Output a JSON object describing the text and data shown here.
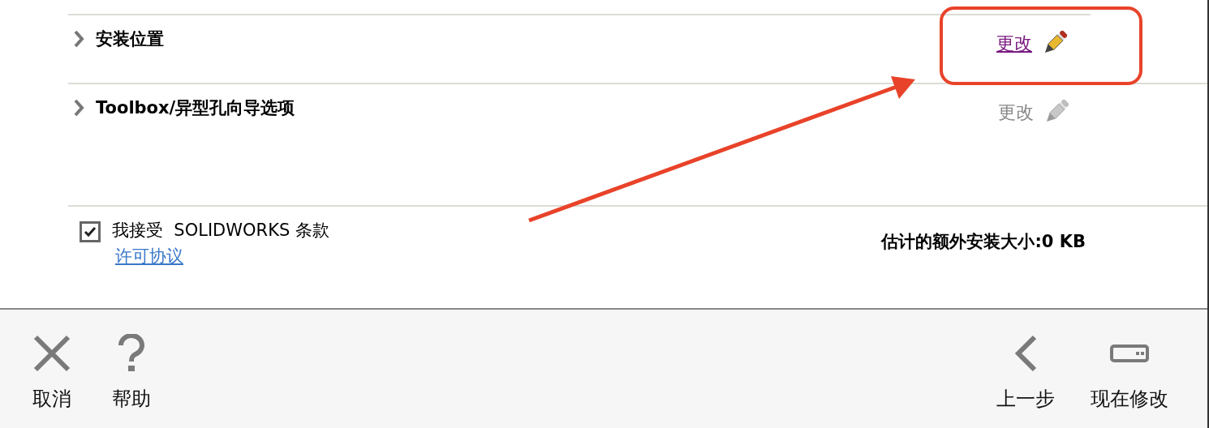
{
  "sections": [
    {
      "label": "安装位置",
      "expanded": false,
      "action": {
        "label": "更改",
        "disabled": false
      }
    },
    {
      "label": "Toolbox/异型孔向导选项",
      "expanded": false,
      "action": {
        "label": "更改",
        "disabled": true
      }
    }
  ],
  "agreement": {
    "label": "我接受  SOLIDWORKS 条款",
    "checked": true,
    "link": "许可协议"
  },
  "estimate": "估计的额外安装大小:0 KB",
  "footer": {
    "left": [
      {
        "kind": "cancel",
        "label": "取消"
      },
      {
        "kind": "help",
        "label": "帮助"
      }
    ],
    "right": [
      {
        "kind": "back",
        "label": "上一步"
      },
      {
        "kind": "modify",
        "label": "现在修改"
      }
    ]
  }
}
